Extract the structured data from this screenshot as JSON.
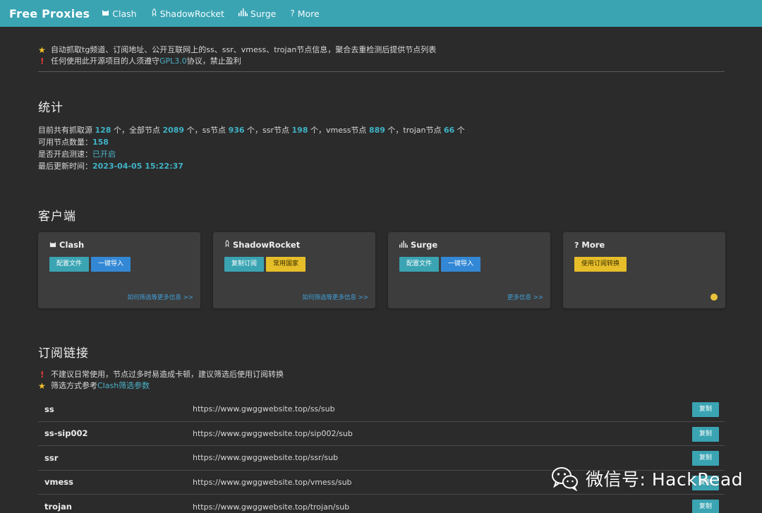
{
  "nav": {
    "brand": "Free Proxies",
    "items": [
      {
        "label": "Clash",
        "icon": "cat-icon"
      },
      {
        "label": "ShadowRocket",
        "icon": "rocket-icon"
      },
      {
        "label": "Surge",
        "icon": "signal-icon"
      },
      {
        "label": "More",
        "icon": "question-icon"
      }
    ]
  },
  "intro": {
    "line1": "自动抓取tg频道、订阅地址、公开互联网上的ss、ssr、vmess、trojan节点信息，聚合去重检测后提供节点列表",
    "line2_pre": "任何使用此开源项目的人须遵守",
    "line2_link": "GPL3.0",
    "line2_post": "协议，禁止盈利"
  },
  "stats": {
    "heading": "统计",
    "t1": "目前共有抓取源 ",
    "sources": "128",
    "t2": " 个，全部节点 ",
    "all_nodes": "2089",
    "t3": " 个，ss节点 ",
    "ss": "936",
    "t4": " 个，ssr节点 ",
    "ssr": "198",
    "t5": " 个，vmess节点 ",
    "vmess": "889",
    "t6": " 个，trojan节点 ",
    "trojan": "66",
    "t7": " 个",
    "available_label": "可用节点数量：",
    "available": "158",
    "speedtest_label": "是否开启测速：",
    "speedtest": "已开启",
    "updated_label": "最后更新时间：",
    "updated": "2023-04-05 15:22:37"
  },
  "clients": {
    "heading": "客户端",
    "clash": {
      "title": "Clash",
      "btn1": "配置文件",
      "btn2": "一键导入",
      "link": "如何筛选等更多信息 >>"
    },
    "shadowrocket": {
      "title": "ShadowRocket",
      "btn1": "复制订阅",
      "btn2": "常用国家",
      "link": "如何筛选等更多信息 >>"
    },
    "surge": {
      "title": "Surge",
      "btn1": "配置文件",
      "btn2": "一键导入",
      "link": "更多信息 >>"
    },
    "more": {
      "title": "More",
      "btn1": "使用订阅转换"
    }
  },
  "subscriptions": {
    "heading": "订阅链接",
    "note1": "不建议日常使用，节点过多时易造成卡顿，建议筛选后使用订阅转换",
    "note2_pre": "筛选方式参考",
    "note2_link": "Clash筛选参数",
    "copy_label": "复制",
    "rows": [
      {
        "name": "ss",
        "url": "https://www.gwggwebsite.top/ss/sub"
      },
      {
        "name": "ss-sip002",
        "url": "https://www.gwggwebsite.top/sip002/sub"
      },
      {
        "name": "ssr",
        "url": "https://www.gwggwebsite.top/ssr/sub"
      },
      {
        "name": "vmess",
        "url": "https://www.gwggwebsite.top/vmess/sub"
      },
      {
        "name": "trojan",
        "url": "https://www.gwggwebsite.top/trojan/sub"
      }
    ]
  },
  "watermark": "微信号: HackRead",
  "colors": {
    "nav": "#3aa4b3",
    "accent": "#3fb3c7",
    "background": "#2b2b2b",
    "card": "#3d3d3d",
    "button_blue": "#3388d6",
    "button_yellow": "#e6be2a"
  }
}
